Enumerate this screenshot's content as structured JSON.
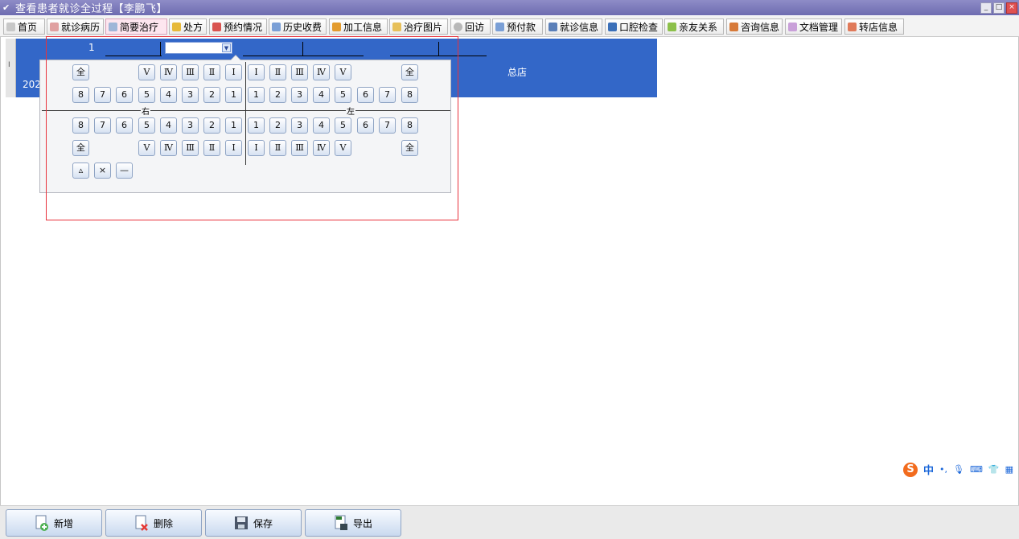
{
  "window": {
    "title": "查看患者就诊全过程【李鹏飞】",
    "controls": [
      "_",
      "□",
      "×"
    ]
  },
  "tabs": [
    {
      "label": "首页",
      "icon": "home-icon",
      "active": false
    },
    {
      "label": "就诊病历",
      "icon": "record-icon",
      "active": false
    },
    {
      "label": "简要治疗",
      "icon": "treatment-icon",
      "active": true
    },
    {
      "label": "处方",
      "icon": "prescription-icon",
      "active": false
    },
    {
      "label": "预约情况",
      "icon": "calendar-icon",
      "active": false
    },
    {
      "label": "历史收费",
      "icon": "billing-icon",
      "active": false
    },
    {
      "label": "加工信息",
      "icon": "processing-icon",
      "active": false
    },
    {
      "label": "治疗图片",
      "icon": "image-icon",
      "active": false
    },
    {
      "label": "回访",
      "icon": "followup-icon",
      "active": false
    },
    {
      "label": "预付款",
      "icon": "prepay-icon",
      "active": false
    },
    {
      "label": "就诊信息",
      "icon": "info-icon",
      "active": false
    },
    {
      "label": "口腔检查",
      "icon": "exam-icon",
      "active": false
    },
    {
      "label": "亲友关系",
      "icon": "relatives-icon",
      "active": false
    },
    {
      "label": "咨询信息",
      "icon": "consult-icon",
      "active": false
    },
    {
      "label": "文档管理",
      "icon": "document-icon",
      "active": false
    },
    {
      "label": "转店信息",
      "icon": "transfer-icon",
      "active": false
    }
  ],
  "grid": {
    "row_number": "1",
    "date_partial": "2023",
    "store": "总店",
    "row_marker": "I"
  },
  "tooth_picker": {
    "upper_deciduous_left": [
      "全",
      "Ⅴ",
      "Ⅳ",
      "Ⅲ",
      "Ⅱ",
      "Ⅰ"
    ],
    "upper_deciduous_right": [
      "Ⅰ",
      "Ⅱ",
      "Ⅲ",
      "Ⅳ",
      "Ⅴ",
      "全"
    ],
    "upper_permanent_left": [
      "8",
      "7",
      "6",
      "5",
      "4",
      "3",
      "2",
      "1"
    ],
    "upper_permanent_right": [
      "1",
      "2",
      "3",
      "4",
      "5",
      "6",
      "7",
      "8"
    ],
    "lower_permanent_left": [
      "8",
      "7",
      "6",
      "5",
      "4",
      "3",
      "2",
      "1"
    ],
    "lower_permanent_right": [
      "1",
      "2",
      "3",
      "4",
      "5",
      "6",
      "7",
      "8"
    ],
    "lower_deciduous_left": [
      "全",
      "Ⅴ",
      "Ⅳ",
      "Ⅲ",
      "Ⅱ",
      "Ⅰ"
    ],
    "lower_deciduous_right": [
      "Ⅰ",
      "Ⅱ",
      "Ⅲ",
      "Ⅳ",
      "Ⅴ",
      "全"
    ],
    "right_label": "右",
    "left_label": "左",
    "extra_buttons": [
      "▵",
      "×",
      "—"
    ]
  },
  "bottom_buttons": [
    {
      "label": "新增",
      "icon": "add-icon"
    },
    {
      "label": "删除",
      "icon": "delete-icon"
    },
    {
      "label": "保存",
      "icon": "save-icon"
    },
    {
      "label": "导出",
      "icon": "export-icon"
    }
  ],
  "ime": {
    "logo": "S",
    "mode": "中"
  }
}
